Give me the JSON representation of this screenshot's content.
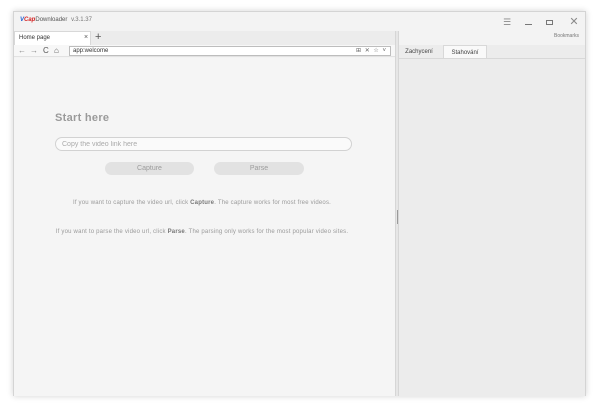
{
  "app": {
    "logo_v": "V",
    "logo_cap": "Cap",
    "name": "Downloader",
    "version": "v.3.1.37"
  },
  "window_controls": {
    "menu_icon": "☰",
    "close_icon": "✕"
  },
  "bookmarks_label": "Bookmarks",
  "browser_tab": {
    "label": "Home page",
    "close_icon": "×",
    "new_tab_icon": "+"
  },
  "nav": {
    "back_icon": "←",
    "forward_icon": "→",
    "reload_icon": "C",
    "home_icon": "⌂",
    "url": "app:welcome",
    "url_actions": "⊞ ✕ ☆ ˅"
  },
  "content": {
    "heading": "Start here",
    "input_placeholder": "Copy the video link here",
    "input_value": "",
    "capture_button": "Capture",
    "parse_button": "Parse",
    "info_1_before": "If you want to capture the video url, click ",
    "info_1_bold": "Capture",
    "info_1_after": ". The capture works for most free videos.",
    "info_2_before": "If you want to parse the video url, click ",
    "info_2_bold": "Parse",
    "info_2_after": ". The parsing only works for the most popular video sites."
  },
  "right_panel": {
    "tabs": [
      {
        "label": "Zachycení",
        "active": false
      },
      {
        "label": "Stahování",
        "active": true
      }
    ]
  }
}
